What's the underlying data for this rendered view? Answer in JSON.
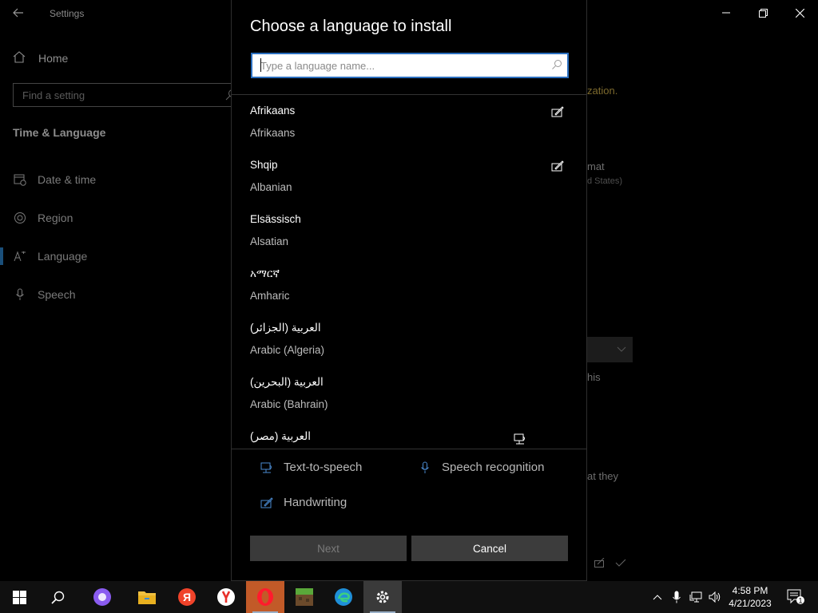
{
  "settings": {
    "app_title": "Settings",
    "home_label": "Home",
    "search_placeholder": "Find a setting",
    "section_title": "Time & Language",
    "nav_items": [
      {
        "label": "Date & time",
        "icon": "calendar-clock-icon"
      },
      {
        "label": "Region",
        "icon": "globe-icon"
      },
      {
        "label": "Language",
        "icon": "language-icon"
      },
      {
        "label": "Speech",
        "icon": "microphone-icon"
      }
    ],
    "background_fragments": {
      "frag1": "zation.",
      "frag2": "mat",
      "frag3": "d States)",
      "frag4": "his",
      "frag5": "at they"
    },
    "colors": {
      "accent_bar": "#1a4f7a"
    }
  },
  "dialog": {
    "title": "Choose a language to install",
    "search_placeholder": "Type a language name...",
    "languages": [
      {
        "native": "Afrikaans",
        "english": "Afrikaans",
        "feature_icon": "handwriting-icon"
      },
      {
        "native": "Shqip",
        "english": "Albanian",
        "feature_icon": "handwriting-icon"
      },
      {
        "native": "Elsässisch",
        "english": "Alsatian",
        "feature_icon": ""
      },
      {
        "native": "አማርኛ",
        "english": "Amharic",
        "feature_icon": ""
      },
      {
        "native": "العربية (الجزائر)",
        "english": "Arabic (Algeria)",
        "feature_icon": ""
      },
      {
        "native": "العربية (البحرين)",
        "english": "Arabic (Bahrain)",
        "feature_icon": ""
      },
      {
        "native": "العربية (مصر)",
        "english": "",
        "feature_icon": "text-to-speech-icon"
      }
    ],
    "legend": {
      "tts_label": "Text-to-speech",
      "speech_label": "Speech recognition",
      "handwriting_label": "Handwriting"
    },
    "buttons": {
      "next_label": "Next",
      "cancel_label": "Cancel"
    }
  },
  "taskbar": {
    "time": "4:58 PM",
    "date": "4/21/2023",
    "notification_count": "1",
    "apps": [
      "start-icon",
      "search-icon",
      "alice-icon",
      "file-explorer-icon",
      "yandex-icon",
      "yandex-browser-icon",
      "opera-icon",
      "minecraft-icon",
      "edge-icon",
      "settings-icon"
    ]
  }
}
